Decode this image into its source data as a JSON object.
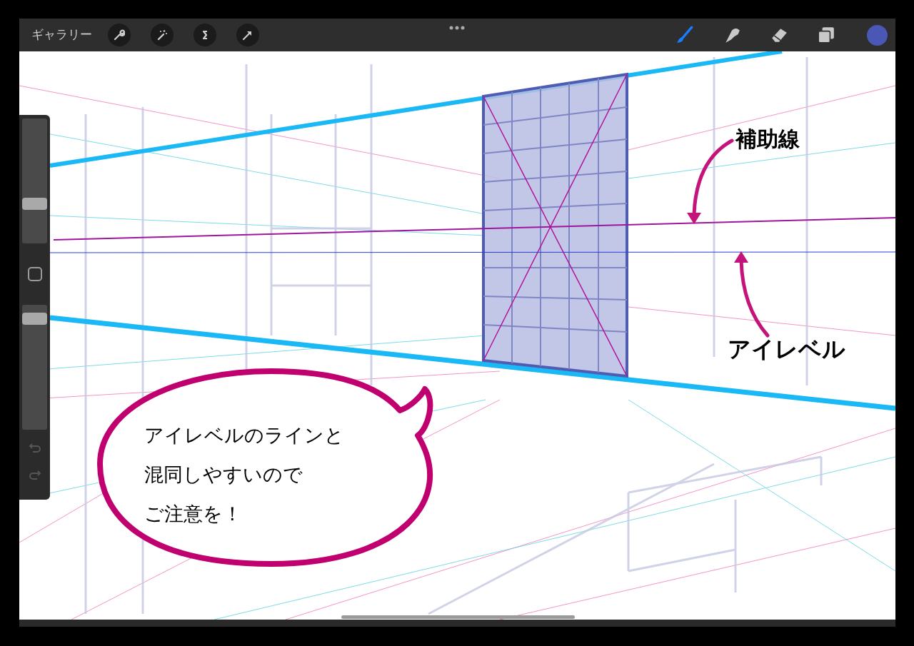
{
  "top_bar": {
    "gallery_label": "ギャラリー"
  },
  "tools": [
    {
      "kind": "brush",
      "selected": true
    },
    {
      "kind": "smudge",
      "selected": false
    },
    {
      "kind": "eraser",
      "selected": false
    },
    {
      "kind": "layers",
      "selected": false
    }
  ],
  "sidebar": {
    "brush_size": {
      "level": 0.3
    },
    "opacity": {
      "level": 0.93
    }
  },
  "canvas": {
    "labels": [
      "補助線",
      "アイレベル"
    ],
    "speech_bubble": [
      "アイレベルのラインと",
      "混同しやすいので",
      "ご注意を！"
    ]
  }
}
